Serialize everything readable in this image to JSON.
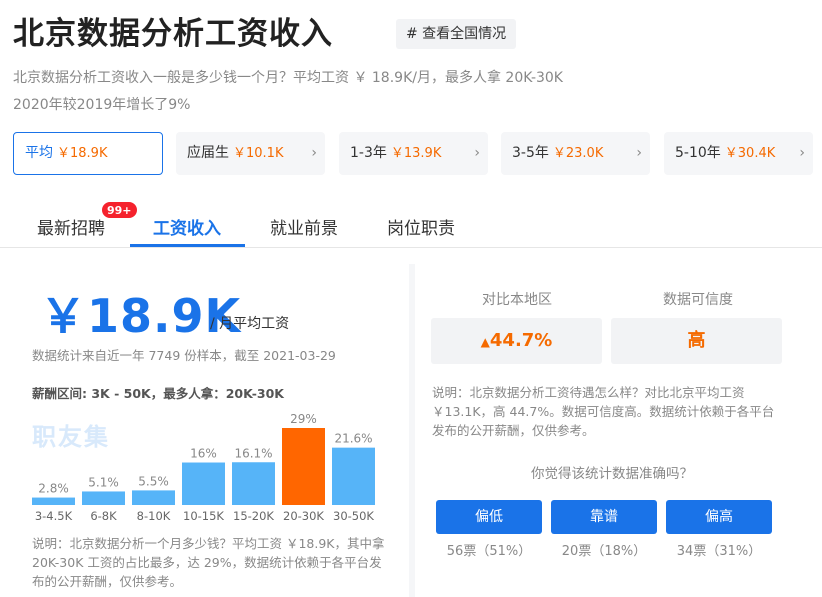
{
  "header": {
    "title": "北京数据分析工资收入",
    "tag_button": "# 查看全国情况",
    "desc_line1": "北京数据分析工资收入一般是多少钱一个月？平均工资 ￥ 18.9K/月，最多人拿 20K-30K",
    "desc_line2": "2020年较2019年增长了9%"
  },
  "filters": [
    {
      "label": "平均",
      "value": "￥18.9K",
      "active": true
    },
    {
      "label": "应届生",
      "value": "￥10.1K",
      "active": false
    },
    {
      "label": "1-3年",
      "value": "￥13.9K",
      "active": false
    },
    {
      "label": "3-5年",
      "value": "￥23.0K",
      "active": false
    },
    {
      "label": "5-10年",
      "value": "￥30.4K",
      "active": false
    }
  ],
  "chevron": "›",
  "tabs": [
    {
      "label": "最新招聘"
    },
    {
      "label": "工资收入"
    },
    {
      "label": "就业前景"
    },
    {
      "label": "岗位职责"
    }
  ],
  "badge": "99+",
  "summary": {
    "salary": "￥18.9K",
    "salary_unit": "/ 月平均工资",
    "stat_note": "数据统计来自近一年 7749 份样本，截至 2021-03-29",
    "range_line": "薪酬区间: 3K - 50K，最多人拿：20K-30K",
    "watermark": "职友集",
    "note": "说明：北京数据分析一个月多少钱？平均工资 ￥18.9K，其中拿 20K-30K 工资的占比最多，达 29%，数据统计依赖于各平台发布的公开薪酬，仅供参考。"
  },
  "chart_data": {
    "type": "bar",
    "categories": [
      "3-4.5K",
      "6-8K",
      "8-10K",
      "10-15K",
      "15-20K",
      "20-30K",
      "30-50K"
    ],
    "values": [
      2.8,
      5.1,
      5.5,
      16,
      16.1,
      29,
      21.6
    ],
    "data_labels": [
      "2.8%",
      "5.1%",
      "5.5%",
      "16%",
      "16.1%",
      "29%",
      "21.6%"
    ],
    "highlight_index": 5,
    "bar_color": "#56b4f8",
    "highlight_color": "#ff6600",
    "ylim": [
      0,
      29
    ]
  },
  "compare": {
    "local_title": "对比本地区",
    "local_value": "44.7%",
    "local_arrow": "▲",
    "credibility_title": "数据可信度",
    "credibility_value": "高",
    "note": "说明：北京数据分析工资待遇怎么样？对比北京平均工资 ￥13.1K，高 44.7%。数据可信度高。数据统计依赖于各平台发布的公开薪酬，仅供参考。",
    "question": "你觉得该统计数据准确吗？",
    "votes": [
      {
        "label": "偏低",
        "count": "56票（51%）"
      },
      {
        "label": "靠谱",
        "count": "20票（18%）"
      },
      {
        "label": "偏高",
        "count": "34票（31%）"
      }
    ]
  },
  "colors": {
    "accent": "#1a73e8",
    "money": "#f56a00",
    "badge": "#f5222d"
  }
}
